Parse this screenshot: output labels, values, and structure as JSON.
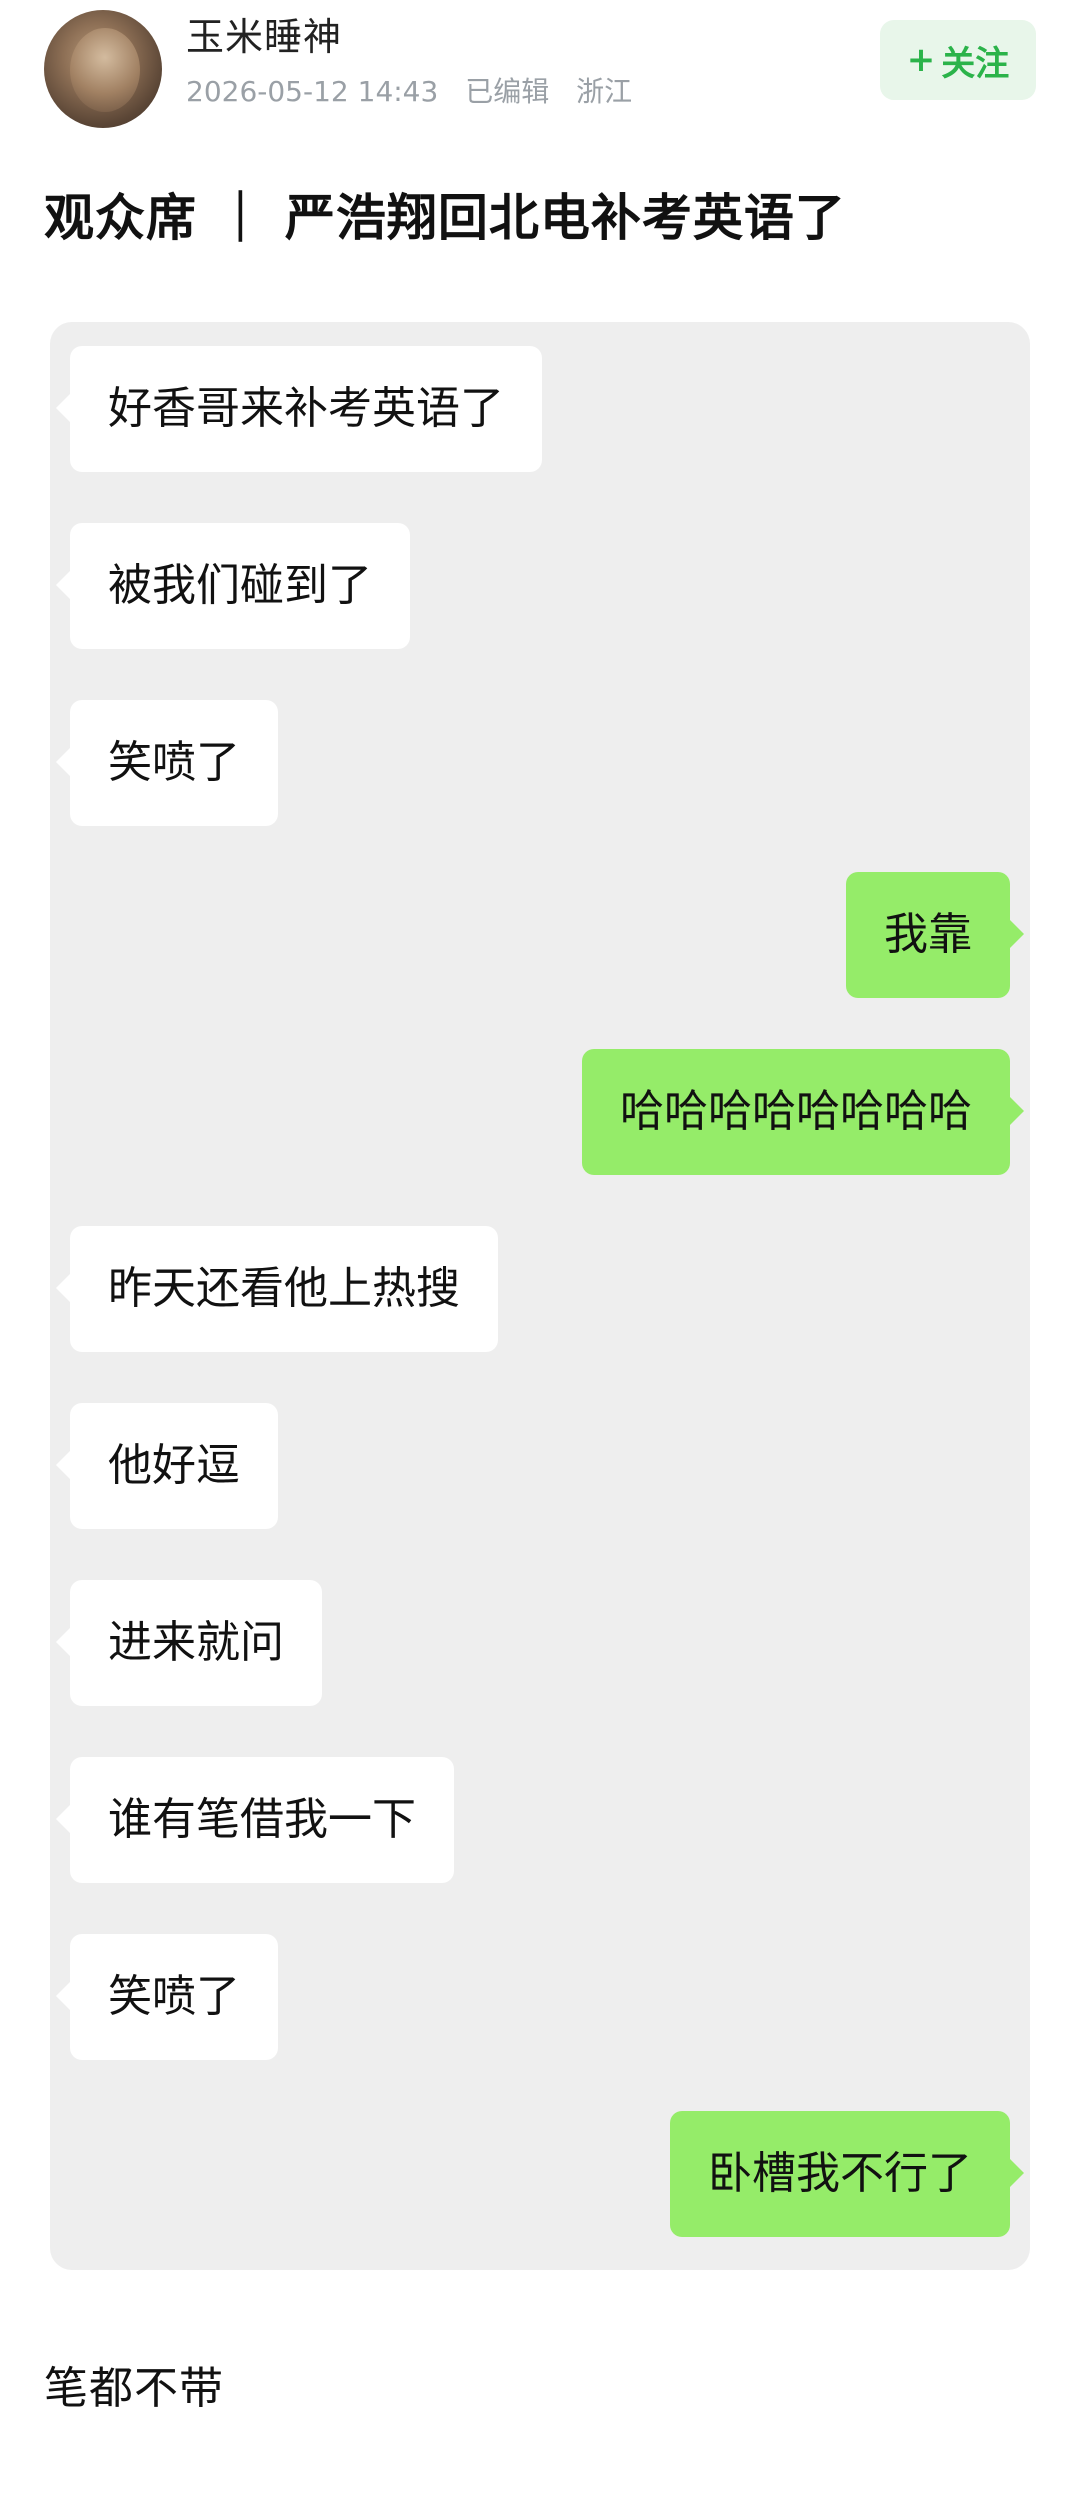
{
  "post": {
    "author": {
      "name": "玉米睡神",
      "date": "2026-05-12 14:43",
      "edited": "已编辑",
      "location": "浙江"
    },
    "follow_label": "关注",
    "follow_icon": "plus-icon",
    "title": "观众席 ｜ 严浩翔回北电补考英语了",
    "caption": "笔都不带"
  },
  "chat": {
    "messages": [
      {
        "side": "left",
        "text": "好香哥来补考英语了"
      },
      {
        "side": "left",
        "text": "被我们碰到了"
      },
      {
        "side": "left",
        "text": "笑喷了"
      },
      {
        "side": "right",
        "text": "我靠"
      },
      {
        "side": "right",
        "text": "哈哈哈哈哈哈哈哈"
      },
      {
        "side": "left",
        "text": "昨天还看他上热搜"
      },
      {
        "side": "left",
        "text": "他好逗"
      },
      {
        "side": "left",
        "text": "进来就问"
      },
      {
        "side": "left",
        "text": "谁有笔借我一下"
      },
      {
        "side": "left",
        "text": "笑喷了"
      },
      {
        "side": "right",
        "text": "卧槽我不行了"
      }
    ],
    "colors": {
      "left_bubble": "#ffffff",
      "right_bubble": "#95ec69",
      "background": "#eeeeee"
    }
  },
  "colors": {
    "accent": "#2bb34a",
    "follow_bg": "#e8f6ea",
    "meta_text": "#9aa0a6"
  }
}
